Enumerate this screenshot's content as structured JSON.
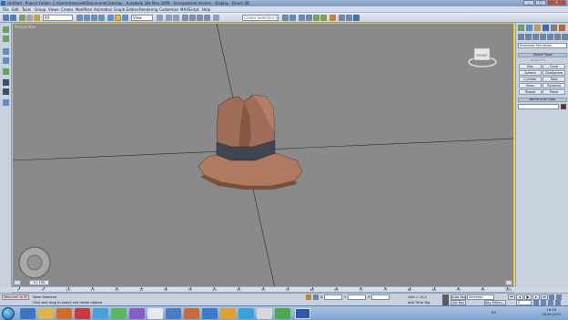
{
  "window": {
    "title": "Untitled - Project Folder: C:\\Users\\Алексей\\Documents\\3dsmax - Autodesk 3ds Max 2009 - Unregistered Version - Display : Direct 3D",
    "minimize": "_",
    "maximize": "□",
    "close": "✕"
  },
  "menu": [
    "File",
    "Edit",
    "Tools",
    "Group",
    "Views",
    "Create",
    "Modifiers",
    "Animation",
    "Graph Editors",
    "Rendering",
    "Customize",
    "MAXScript",
    "Help"
  ],
  "toolbar": {
    "selection_filter": "All",
    "reference_coord": "View",
    "named_selection": "Create Selection Set"
  },
  "viewport": {
    "label": "Perspective",
    "viewcube_face": "FRONT",
    "colors": {
      "background": "#8a8a8a",
      "border": "#e6c13b",
      "hat": "#a0705a",
      "band": "#3e4652"
    }
  },
  "command_panel": {
    "category": "Standard Primitives",
    "object_type_header": "Object Type",
    "autogrid": "AutoGrid",
    "buttons": [
      "Box",
      "Cone",
      "Sphere",
      "GeoSphere",
      "Cylinder",
      "Tube",
      "Torus",
      "Pyramid",
      "Teapot",
      "Plane"
    ],
    "name_color_header": "Name and Color",
    "name_value": ""
  },
  "timeline": {
    "frame_label": "0 / 100",
    "ticks": [
      "0",
      "5",
      "10",
      "15",
      "20",
      "25",
      "30",
      "35",
      "40",
      "45",
      "50",
      "55",
      "60",
      "65",
      "70",
      "75",
      "80",
      "85",
      "90",
      "95",
      "100"
    ]
  },
  "status": {
    "maxscript_listener": "Welcome to M",
    "selection_count": "None Selected",
    "prompt": "Click and drag to select and rotate objects",
    "x_label": "X",
    "y_label": "Y",
    "z_label": "Z",
    "grid": "Grid = 10,0",
    "add_time_tag": "Add Time Tag",
    "auto_key": "Auto Key",
    "selected_dropdown": "Selected",
    "set_key": "Set Key",
    "key_filters": "Key Filters...",
    "frame_value": "0"
  },
  "taskbar": {
    "language": "RU",
    "time": "16:26",
    "date": "16.06.2013"
  }
}
